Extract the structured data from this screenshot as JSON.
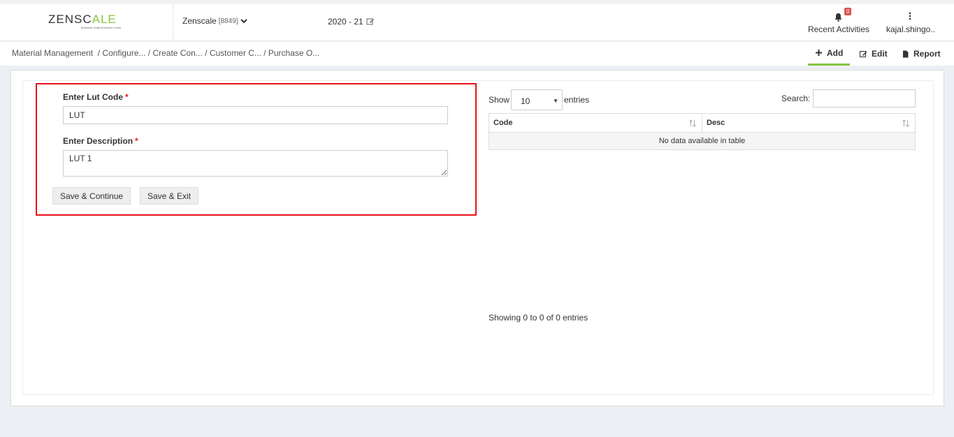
{
  "header": {
    "logo": {
      "part1": "ZENSC",
      "part2": "A",
      "part3": "LE",
      "tagline": "Business Goals Business Focus"
    },
    "company": {
      "name": "Zenscale",
      "code": "[8849]"
    },
    "year": "2020 - 21",
    "activities": {
      "label": "Recent Activities",
      "count": "0"
    },
    "user": {
      "label": "kajal.shingo.."
    }
  },
  "breadcrumb": {
    "root": "Material Management",
    "items": [
      "/ Configure...",
      "/ Create Con...",
      "/ Customer C...",
      "/ Purchase O..."
    ]
  },
  "actions": {
    "add": "Add",
    "edit": "Edit",
    "report": "Report"
  },
  "form": {
    "lut_label": "Enter Lut Code",
    "lut_value": "LUT",
    "desc_label": "Enter Description",
    "desc_value": "LUT 1",
    "required_mark": "*",
    "save_continue": "Save & Continue",
    "save_exit": "Save & Exit"
  },
  "table": {
    "show": "Show",
    "length": "10",
    "entries": "entries",
    "search": "Search:",
    "columns": [
      "Code",
      "Desc"
    ],
    "empty": "No data available in table",
    "info": "Showing 0 to 0 of 0 entries"
  },
  "colors": {
    "accent": "#86c440",
    "highlight": "#e8131b",
    "badge": "#d9534f"
  }
}
